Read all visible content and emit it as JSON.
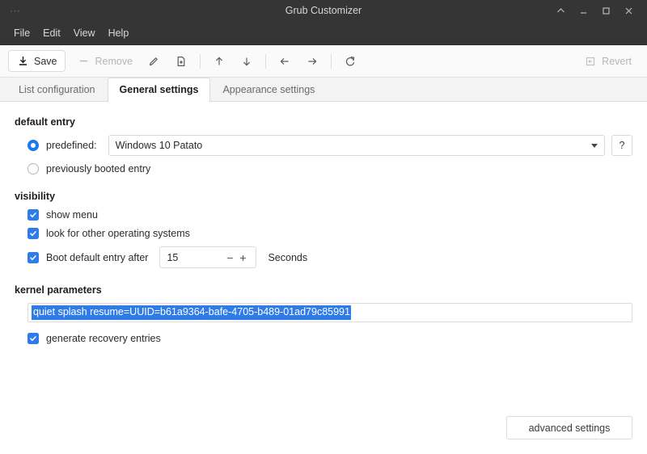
{
  "window": {
    "title": "Grub Customizer",
    "app_menu_icon": "app-menu-dots-icon",
    "controls": {
      "shade_icon": "chevron-up-icon",
      "minimize_icon": "minimize-icon",
      "maximize_icon": "maximize-icon",
      "close_icon": "close-icon"
    }
  },
  "menubar": {
    "items": [
      {
        "label": "File"
      },
      {
        "label": "Edit"
      },
      {
        "label": "View"
      },
      {
        "label": "Help"
      }
    ]
  },
  "toolbar": {
    "save_label": "Save",
    "save_icon": "save-download-icon",
    "remove_label": "Remove",
    "remove_icon": "minus-icon",
    "edit_icon": "pencil-icon",
    "new_icon": "new-document-icon",
    "move_up_icon": "arrow-up-icon",
    "move_down_icon": "arrow-down-icon",
    "move_left_icon": "arrow-left-icon",
    "move_right_icon": "arrow-right-icon",
    "reload_icon": "refresh-icon",
    "revert_label": "Revert",
    "revert_icon": "revert-icon"
  },
  "tabs": [
    {
      "label": "List configuration",
      "active": false
    },
    {
      "label": "General settings",
      "active": true
    },
    {
      "label": "Appearance settings",
      "active": false
    }
  ],
  "sections": {
    "default_entry": {
      "title": "default entry",
      "predefined_label": "predefined:",
      "predefined_selected": true,
      "combo_value": "Windows 10 Patato",
      "help_label": "?",
      "previously_booted_label": "previously booted entry",
      "previously_booted_selected": false
    },
    "visibility": {
      "title": "visibility",
      "show_menu_label": "show menu",
      "show_menu_checked": true,
      "look_other_os_label": "look for other operating systems",
      "look_other_os_checked": true,
      "boot_after_label": "Boot default entry after",
      "boot_after_checked": true,
      "timeout_value": "15",
      "decrement_label": "−",
      "increment_label": "+",
      "unit_label": "Seconds"
    },
    "kernel_parameters": {
      "title": "kernel parameters",
      "value": "quiet splash resume=UUID=b61a9364-bafe-4705-b489-01ad79c85991",
      "value_selected": true,
      "recovery_label": "generate recovery entries",
      "recovery_checked": true
    }
  },
  "footer": {
    "advanced_settings_label": "advanced settings"
  },
  "colors": {
    "titlebar_bg": "#353535",
    "accent_blue": "#2f7ce8",
    "radio_blue": "#1b7aeb",
    "toolbar_bg": "#fafafa",
    "tabstrip_bg": "#f3f3f3",
    "content_bg": "#ffffff"
  }
}
